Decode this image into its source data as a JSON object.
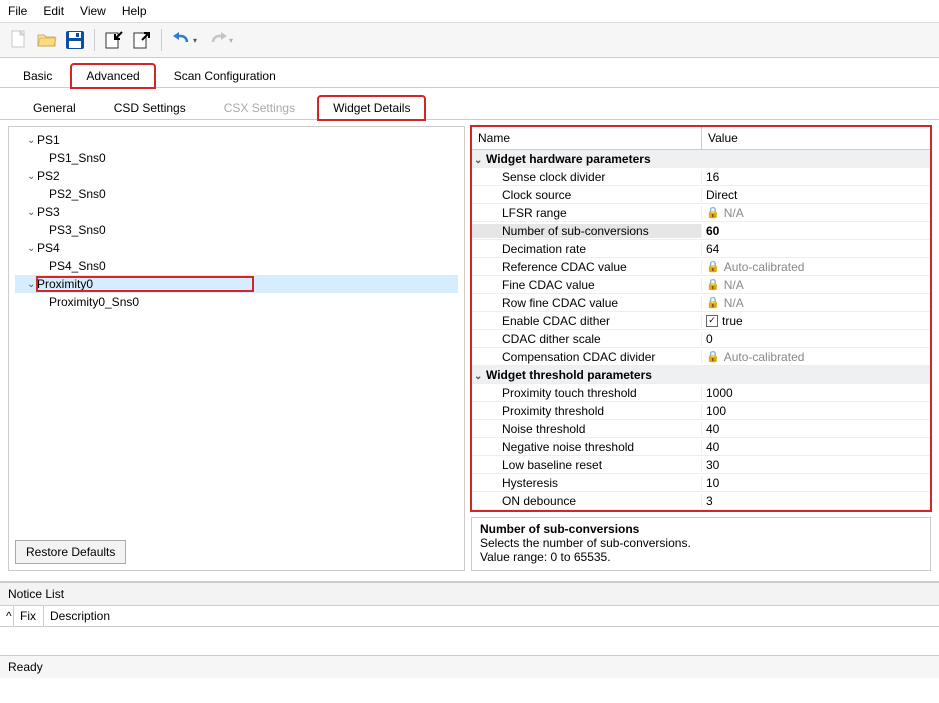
{
  "menu": {
    "file": "File",
    "edit": "Edit",
    "view": "View",
    "help": "Help"
  },
  "toolbar_icons": {
    "new": "new-file-icon",
    "open": "open-folder-icon",
    "save": "save-icon",
    "import": "import-icon",
    "export": "export-icon",
    "undo": "undo-icon",
    "redo": "redo-icon"
  },
  "main_tabs": [
    {
      "label": "Basic",
      "active": false
    },
    {
      "label": "Advanced",
      "active": true,
      "highlight": true
    },
    {
      "label": "Scan Configuration",
      "active": false
    }
  ],
  "sub_tabs": [
    {
      "label": "General",
      "active": false,
      "disabled": false
    },
    {
      "label": "CSD Settings",
      "active": false,
      "disabled": false
    },
    {
      "label": "CSX Settings",
      "active": false,
      "disabled": true
    },
    {
      "label": "Widget Details",
      "active": true,
      "disabled": false,
      "highlight": true
    }
  ],
  "tree": [
    {
      "name": "PS1",
      "expanded": true,
      "children": [
        {
          "name": "PS1_Sns0"
        }
      ]
    },
    {
      "name": "PS2",
      "expanded": true,
      "children": [
        {
          "name": "PS2_Sns0"
        }
      ]
    },
    {
      "name": "PS3",
      "expanded": true,
      "children": [
        {
          "name": "PS3_Sns0"
        }
      ]
    },
    {
      "name": "PS4",
      "expanded": true,
      "children": [
        {
          "name": "PS4_Sns0"
        }
      ]
    },
    {
      "name": "Proximity0",
      "expanded": true,
      "selected": true,
      "highlight": true,
      "children": [
        {
          "name": "Proximity0_Sns0"
        }
      ]
    }
  ],
  "restore_label": "Restore Defaults",
  "prop_headers": {
    "name": "Name",
    "value": "Value"
  },
  "prop_groups": [
    {
      "title": "Widget hardware parameters",
      "rows": [
        {
          "name": "Sense clock divider",
          "value": "16"
        },
        {
          "name": "Clock source",
          "value": "Direct"
        },
        {
          "name": "LFSR range",
          "value": "N/A",
          "locked": true
        },
        {
          "name": "Number of sub-conversions",
          "value": "60",
          "selected": true
        },
        {
          "name": "Decimation rate",
          "value": "64"
        },
        {
          "name": "Reference CDAC value",
          "value": "Auto-calibrated",
          "locked": true
        },
        {
          "name": "Fine CDAC value",
          "value": "N/A",
          "locked": true
        },
        {
          "name": "Row fine CDAC value",
          "value": "N/A",
          "locked": true
        },
        {
          "name": "Enable CDAC dither",
          "value": "true",
          "checkbox": true
        },
        {
          "name": "CDAC dither scale",
          "value": "0"
        },
        {
          "name": "Compensation CDAC divider",
          "value": "Auto-calibrated",
          "locked": true
        }
      ]
    },
    {
      "title": "Widget threshold parameters",
      "rows": [
        {
          "name": "Proximity touch threshold",
          "value": "1000"
        },
        {
          "name": "Proximity threshold",
          "value": "100"
        },
        {
          "name": "Noise threshold",
          "value": "40"
        },
        {
          "name": "Negative noise threshold",
          "value": "40"
        },
        {
          "name": "Low baseline reset",
          "value": "30"
        },
        {
          "name": "Hysteresis",
          "value": "10"
        },
        {
          "name": "ON debounce",
          "value": "3"
        }
      ]
    }
  ],
  "description": {
    "title": "Number of sub-conversions",
    "line1": "Selects the number of sub-conversions.",
    "line2": "Value range: 0 to 65535."
  },
  "notice": {
    "title": "Notice List",
    "col1": "Fix",
    "col2": "Description"
  },
  "status": "Ready"
}
